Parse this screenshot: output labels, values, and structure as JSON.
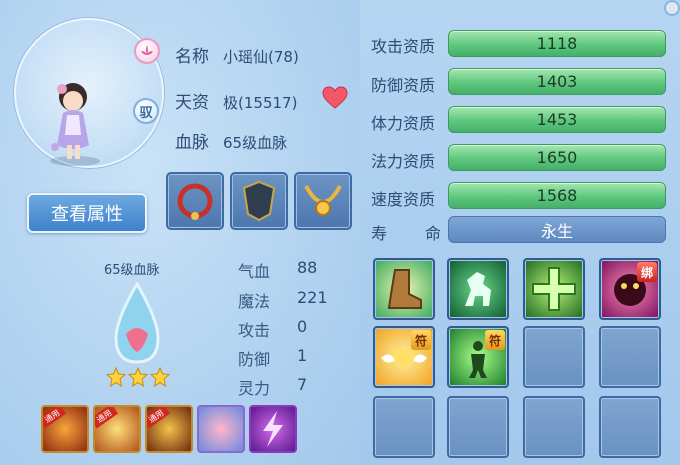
{
  "pet": {
    "name_label": "名称",
    "name_value": "小瑶仙(78)",
    "talent_label": "天资",
    "talent_value": "极(15517)",
    "bloodline_label": "血脉",
    "bloodline_value": "65级血脉",
    "mount_badge": "驭"
  },
  "buttons": {
    "view_attributes": "查看属性"
  },
  "bloodline_panel": {
    "title": "65级血脉",
    "stars": 3,
    "stats": [
      {
        "label": "气血",
        "value": "88"
      },
      {
        "label": "魔法",
        "value": "221"
      },
      {
        "label": "攻击",
        "value": "0"
      },
      {
        "label": "防御",
        "value": "1"
      },
      {
        "label": "灵力",
        "value": "7"
      }
    ],
    "skill_used_tag": "通用"
  },
  "aptitudes": [
    {
      "label": "攻击资质",
      "value": "1118"
    },
    {
      "label": "防御资质",
      "value": "1403"
    },
    {
      "label": "体力资质",
      "value": "1453"
    },
    {
      "label": "法力资质",
      "value": "1650"
    },
    {
      "label": "速度资质",
      "value": "1568"
    }
  ],
  "lifespan": {
    "label_a": "寿",
    "label_b": "命",
    "value": "永生"
  },
  "skills": {
    "fu_tag": "符",
    "bang_tag": "绑"
  },
  "colors": {
    "aptitude_bar": "#5ec77e",
    "button": "#3e82cc",
    "background": "#a9cdee"
  }
}
